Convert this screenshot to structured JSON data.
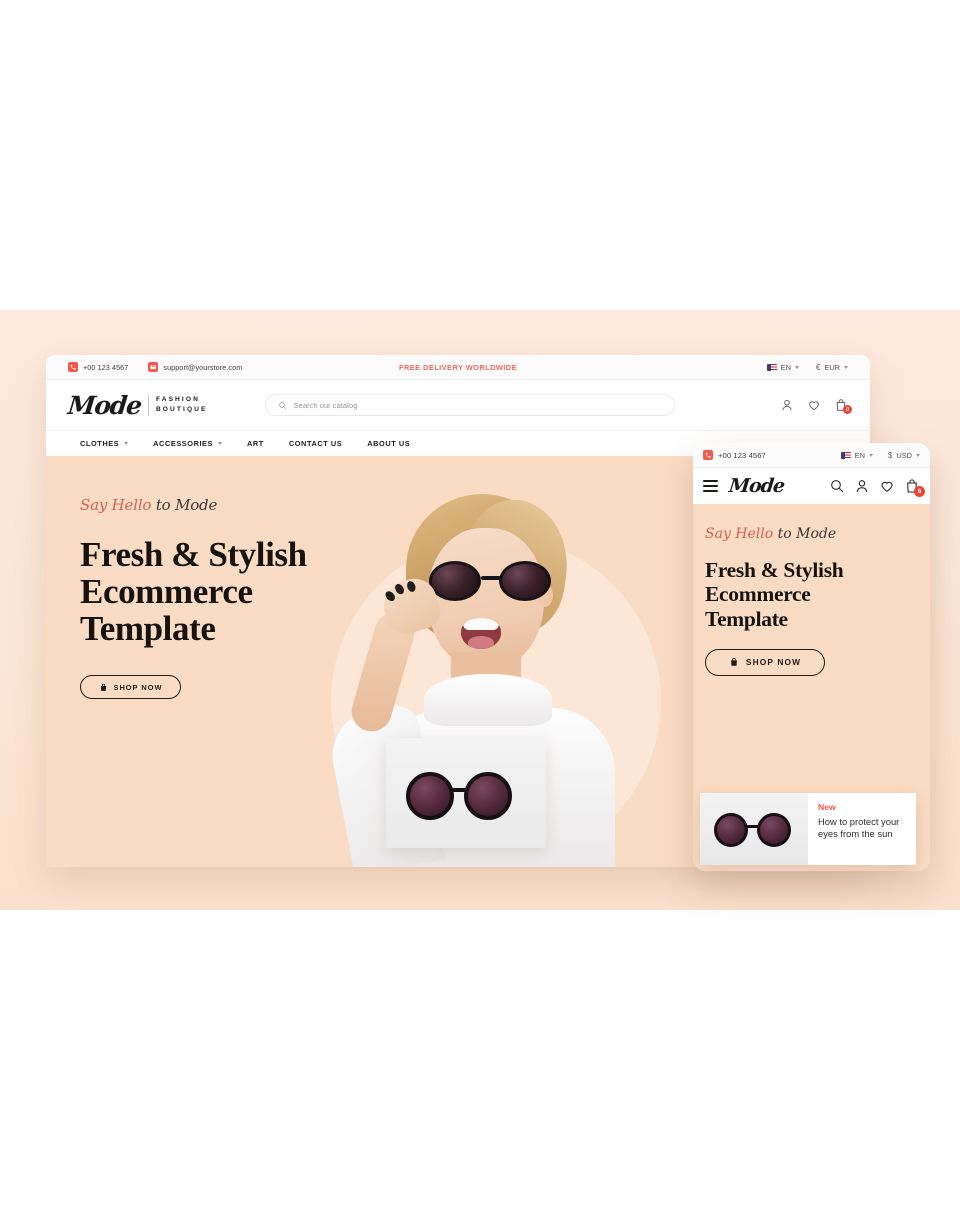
{
  "theme": {
    "accent": "#ef5945",
    "peach_band": "#fbe5d4",
    "hero_bg": "#fadcc4",
    "ink": "#16120f"
  },
  "desktop": {
    "topbar": {
      "phone": "+00 123 4567",
      "phone_icon": "phone-icon",
      "email": "support@yourstore.com",
      "email_icon": "mail-icon",
      "promo": "FREE DELIVERY WORLDWIDE",
      "language": "EN",
      "language_flag": "us-flag-icon",
      "currency_symbol": "€",
      "currency": "EUR"
    },
    "logo": {
      "name": "Mode",
      "tagline_line1": "FASHION",
      "tagline_line2": "BOUTIQUE"
    },
    "search": {
      "placeholder": "Search our catalog",
      "icon": "search-icon"
    },
    "actions": [
      {
        "name": "account-icon",
        "badge": ""
      },
      {
        "name": "wishlist-heart-icon",
        "badge": ""
      },
      {
        "name": "cart-bag-icon",
        "badge": "0"
      }
    ],
    "nav": [
      {
        "label": "CLOTHES",
        "has_dropdown": true
      },
      {
        "label": "ACCESSORIES",
        "has_dropdown": true
      },
      {
        "label": "ART",
        "has_dropdown": false
      },
      {
        "label": "CONTACT US",
        "has_dropdown": false
      },
      {
        "label": "ABOUT US",
        "has_dropdown": false
      }
    ],
    "hero": {
      "eyebrow_a": "Say Hello ",
      "eyebrow_b": "to ",
      "eyebrow_c": "Mode",
      "heading_line1": "Fresh & Stylish",
      "heading_line2": "Ecommerce",
      "heading_line3": "Template",
      "cta_label": "SHOP NOW",
      "cta_icon": "shopping-bag-icon"
    }
  },
  "mobile": {
    "topbar": {
      "phone": "+00 123 4567",
      "phone_icon": "phone-icon",
      "language": "EN",
      "language_flag": "us-flag-icon",
      "currency_symbol": "$",
      "currency": "USD"
    },
    "menu_icon": "hamburger-menu-icon",
    "logo": {
      "name": "Mode"
    },
    "actions": [
      {
        "name": "search-icon",
        "badge": ""
      },
      {
        "name": "account-icon",
        "badge": ""
      },
      {
        "name": "wishlist-heart-icon",
        "badge": ""
      },
      {
        "name": "cart-bag-icon",
        "badge": "6"
      }
    ],
    "hero": {
      "eyebrow_a": "Say Hello ",
      "eyebrow_b": "to ",
      "eyebrow_c": "Mode",
      "heading_line1": "Fresh & Stylish",
      "heading_line2": "Ecommerce",
      "heading_line3": "Template",
      "cta_label": "SHOP NOW",
      "cta_icon": "shopping-bag-icon"
    },
    "card": {
      "badge": "New",
      "title_line1": "How to protect your",
      "title_line2": "eyes from the sun",
      "image": "sunglasses-product-image"
    }
  }
}
